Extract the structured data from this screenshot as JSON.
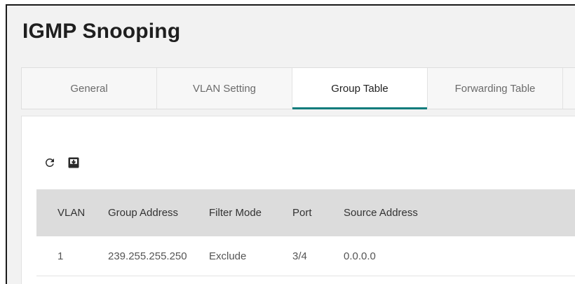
{
  "page": {
    "title": "IGMP Snooping"
  },
  "tabs": [
    {
      "label": "General",
      "active": false
    },
    {
      "label": "VLAN Setting",
      "active": false
    },
    {
      "label": "Group Table",
      "active": true
    },
    {
      "label": "Forwarding Table",
      "active": false
    }
  ],
  "toolbar": {
    "refresh_icon": "refresh-icon",
    "export_icon": "export-icon"
  },
  "table": {
    "columns": [
      "VLAN",
      "Group Address",
      "Filter Mode",
      "Port",
      "Source Address"
    ],
    "rows": [
      [
        "1",
        "239.255.255.250",
        "Exclude",
        "3/4",
        "0.0.0.0"
      ]
    ]
  },
  "colors": {
    "accent": "#0f7c7c",
    "header_bg": "#dcdcdc",
    "page_bg": "#f2f2f2"
  }
}
